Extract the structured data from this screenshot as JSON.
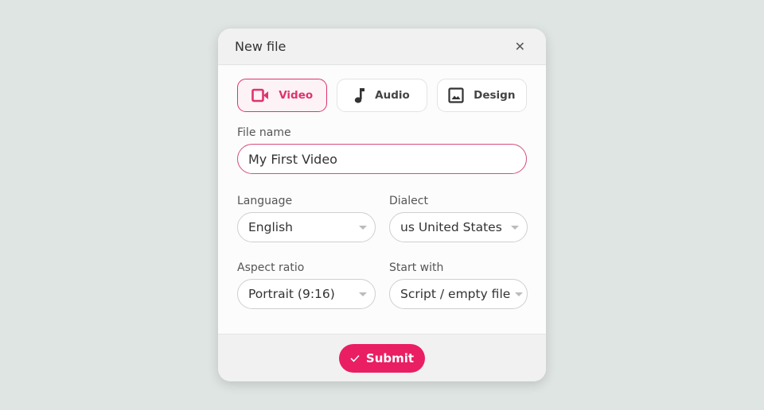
{
  "dialog": {
    "title": "New file",
    "close_icon": "close-icon"
  },
  "types": [
    {
      "label": "Video",
      "icon": "video-camera-icon",
      "active": true
    },
    {
      "label": "Audio",
      "icon": "music-note-icon",
      "active": false
    },
    {
      "label": "Design",
      "icon": "image-icon",
      "active": false
    }
  ],
  "file_name": {
    "label": "File name",
    "value": "My First Video"
  },
  "language": {
    "label": "Language",
    "value": "English"
  },
  "dialect": {
    "label": "Dialect",
    "value": "us United States"
  },
  "aspect_ratio": {
    "label": "Aspect ratio",
    "value": "Portrait (9:16)"
  },
  "start_with": {
    "label": "Start with",
    "value": "Script / empty file"
  },
  "submit": {
    "label": "Submit",
    "icon": "check-icon"
  },
  "colors": {
    "accent": "#e91e63",
    "background": "#dfe5e3"
  }
}
